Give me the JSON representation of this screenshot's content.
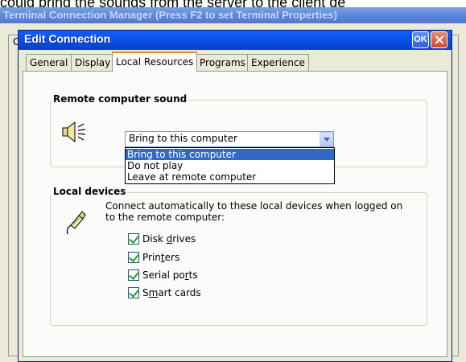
{
  "top_text": "could bring the sounds from the server to the client de",
  "background_window": {
    "title": "Terminal Connection Manager (Press F2 to set Terminal Properties)",
    "panel_label": "C"
  },
  "dialog": {
    "title": "Edit Connection",
    "ok_label": "OK"
  },
  "tabs": [
    {
      "label": "General",
      "active": false
    },
    {
      "label": "Display",
      "active": false
    },
    {
      "label": "Local Resources",
      "active": true
    },
    {
      "label": "Programs",
      "active": false
    },
    {
      "label": "Experience",
      "active": false
    }
  ],
  "sound_group": {
    "title": "Remote computer sound",
    "selected": "Bring to this computer",
    "options": [
      "Bring to this computer",
      "Do not play",
      "Leave at remote computer"
    ],
    "icon": "speaker-icon"
  },
  "devices_group": {
    "title": "Local devices",
    "description_line1": "Connect automatically to these local devices when logged on",
    "description_line2": "to the remote computer:",
    "icon": "plug-icon",
    "items": [
      {
        "before": "Disk ",
        "mnemonic": "d",
        "after": "rives",
        "checked": true
      },
      {
        "before": "Prin",
        "mnemonic": "t",
        "after": "ers",
        "checked": true
      },
      {
        "before": "Serial po",
        "mnemonic": "r",
        "after": "ts",
        "checked": true
      },
      {
        "before": "S",
        "mnemonic": "m",
        "after": "art cards",
        "checked": true
      }
    ]
  }
}
